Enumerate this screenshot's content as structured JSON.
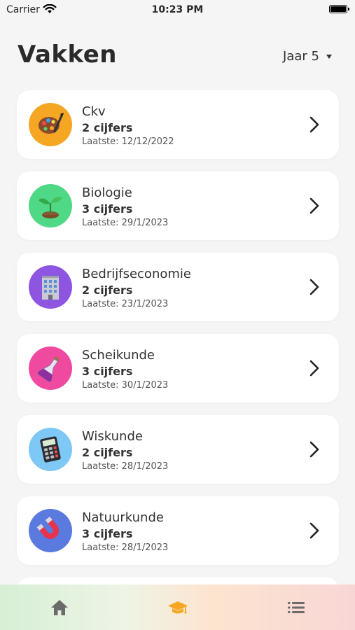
{
  "status_bar": {
    "carrier": "Carrier",
    "time": "10:23 PM"
  },
  "header": {
    "title": "Vakken",
    "year_selector": "Jaar 5"
  },
  "subjects": [
    {
      "name": "Ckv",
      "count": "2 cijfers",
      "last": "Laatste: 12/12/2022",
      "icon": "palette-icon",
      "color": "#f5a623"
    },
    {
      "name": "Biologie",
      "count": "3 cijfers",
      "last": "Laatste: 29/1/2023",
      "icon": "seedling-icon",
      "color": "#4fd987"
    },
    {
      "name": "Bedrijfseconomie",
      "count": "2 cijfers",
      "last": "Laatste: 23/1/2023",
      "icon": "office-building-icon",
      "color": "#8e55e0"
    },
    {
      "name": "Scheikunde",
      "count": "3 cijfers",
      "last": "Laatste: 30/1/2023",
      "icon": "flask-icon",
      "color": "#f04aa0"
    },
    {
      "name": "Wiskunde",
      "count": "2 cijfers",
      "last": "Laatste: 28/1/2023",
      "icon": "calculator-icon",
      "color": "#7ec8f5"
    },
    {
      "name": "Natuurkunde",
      "count": "3 cijfers",
      "last": "Laatste: 28/1/2023",
      "icon": "magnet-icon",
      "color": "#5a7ae0"
    }
  ],
  "tab_bar": {
    "tabs": [
      {
        "name": "home",
        "icon": "home-icon",
        "active": false
      },
      {
        "name": "subjects",
        "icon": "graduation-cap-icon",
        "active": true,
        "color": "#f5a623"
      },
      {
        "name": "list",
        "icon": "list-icon",
        "active": false
      }
    ]
  }
}
